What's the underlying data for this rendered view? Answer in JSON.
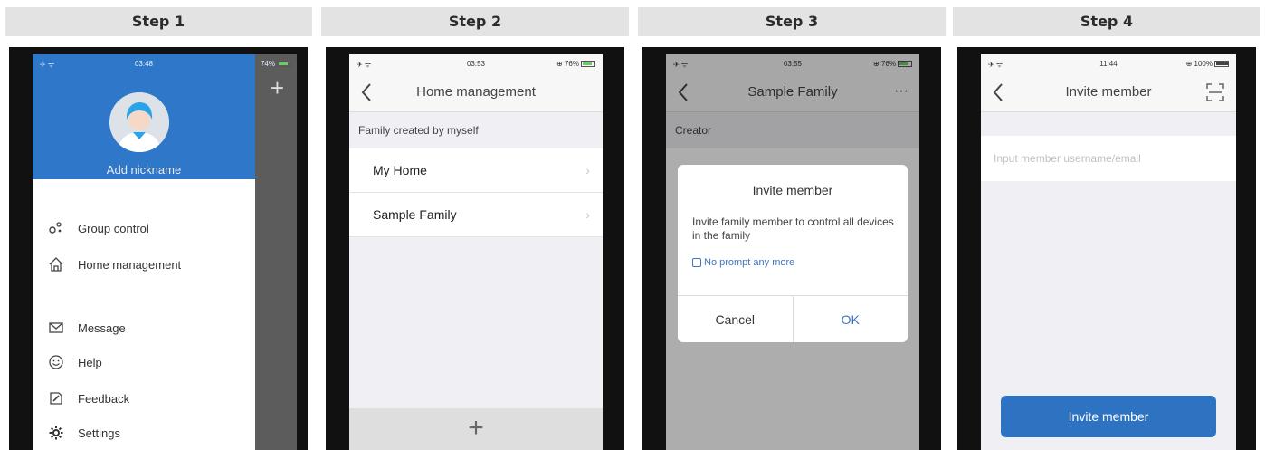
{
  "steps": [
    {
      "label": "Step 1"
    },
    {
      "label": "Step 2"
    },
    {
      "label": "Step 3"
    },
    {
      "label": "Step 4"
    }
  ],
  "screen1": {
    "status": {
      "time": "03:48",
      "battery": "74%"
    },
    "nickname": "Add nickname",
    "menu": [
      {
        "label": "Group control",
        "icon": "group-control-icon"
      },
      {
        "label": "Home management",
        "icon": "home-icon"
      },
      {
        "label": "Message",
        "icon": "envelope-icon"
      },
      {
        "label": "Help",
        "icon": "smiley-icon"
      },
      {
        "label": "Feedback",
        "icon": "edit-icon"
      },
      {
        "label": "Settings",
        "icon": "gear-icon"
      }
    ]
  },
  "screen2": {
    "status": {
      "time": "03:53",
      "battery": "76%"
    },
    "title": "Home management",
    "section": "Family created by myself",
    "families": [
      {
        "name": "My Home"
      },
      {
        "name": "Sample Family"
      }
    ]
  },
  "screen3": {
    "status": {
      "time": "03:55",
      "battery": "76%"
    },
    "title": "Sample Family",
    "more": "···",
    "section": "Creator",
    "dialog": {
      "title": "Invite member",
      "message": "Invite family member to control all devices in the family",
      "checkbox": "No prompt any more",
      "cancel": "Cancel",
      "ok": "OK"
    }
  },
  "screen4": {
    "status": {
      "time": "11:44",
      "battery": "100%"
    },
    "title": "Invite member",
    "input_placeholder": "Input member username/email",
    "button": "Invite member"
  },
  "colors": {
    "accent": "#2e73c1",
    "header_blue": "#2f78c9",
    "frame": "#111111",
    "step_header": "#e3e3e3"
  }
}
